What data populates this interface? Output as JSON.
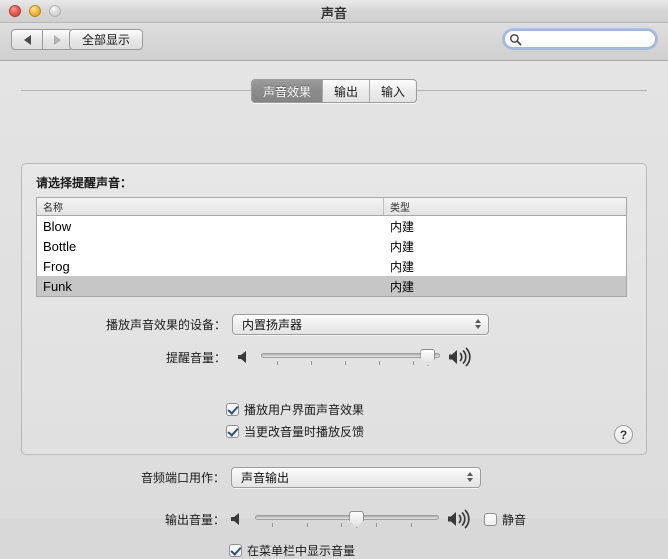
{
  "window": {
    "title": "声音",
    "traffic_lights": [
      "close-button",
      "minimize-button",
      "zoom-button"
    ]
  },
  "toolbar": {
    "back_label": "back-arrow",
    "forward_label": "forward-arrow",
    "show_all_label": "全部显示",
    "search_placeholder": "",
    "search_value": ""
  },
  "tabs": [
    {
      "label": "声音效果",
      "selected": true
    },
    {
      "label": "输出",
      "selected": false
    },
    {
      "label": "输入",
      "selected": false
    }
  ],
  "effects": {
    "list_label": "请选择提醒声音：",
    "columns": [
      "名称",
      "类型"
    ],
    "rows": [
      {
        "name": "Blow",
        "type": "内建",
        "selected": false
      },
      {
        "name": "Bottle",
        "type": "内建",
        "selected": false
      },
      {
        "name": "Frog",
        "type": "内建",
        "selected": false
      },
      {
        "name": "Funk",
        "type": "内建",
        "selected": true
      }
    ],
    "device_label": "播放声音效果的设备：",
    "device_value": "内置扬声器",
    "alert_volume_label": "提醒音量：",
    "alert_volume_percent": 93,
    "checkbox_ui_effects": {
      "label": "播放用户界面声音效果",
      "checked": true
    },
    "checkbox_volume_feedback": {
      "label": "当更改音量时播放反馈",
      "checked": true
    },
    "help_label": "?"
  },
  "output": {
    "port_label": "音频端口用作：",
    "port_value": "声音输出",
    "output_volume_label": "输出音量：",
    "output_volume_percent": 55,
    "mute": {
      "label": "静音",
      "checked": false
    },
    "menubar": {
      "label": "在菜单栏中显示音量",
      "checked": true
    }
  },
  "colors": {
    "selection_gray": "#c6c6c6",
    "tab_selected": "#8b8b8b",
    "checkmark_blue": "#2c4f7c",
    "search_focus_ring": "#7daade"
  }
}
